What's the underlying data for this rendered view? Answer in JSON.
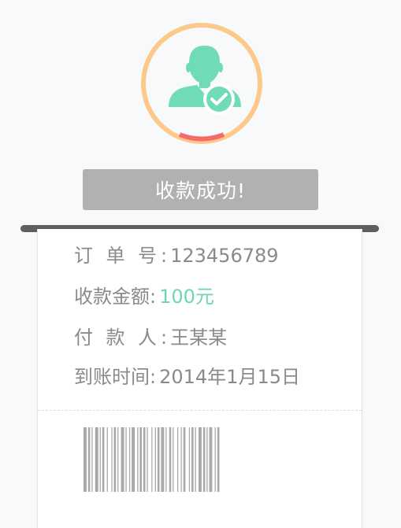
{
  "status": {
    "title": "收款成功!",
    "avatar_icon": "user-check-icon",
    "ring_color": "#fdc98b",
    "ring_accent_color": "#f26c6c",
    "icon_color": "#6fdbb7"
  },
  "order": {
    "number_label_chars": [
      "订",
      "单",
      "号"
    ],
    "number_value": "123456789",
    "amount_label": "收款金额",
    "amount_value": "100元",
    "payer_label_chars": [
      "付",
      "款",
      "人"
    ],
    "payer_value": "王某某",
    "time_label": "到账时间",
    "time_value": "2014年1月15日",
    "separator": ":"
  },
  "barcode": {
    "icon": "barcode-icon",
    "color": "#a9a9a9"
  }
}
